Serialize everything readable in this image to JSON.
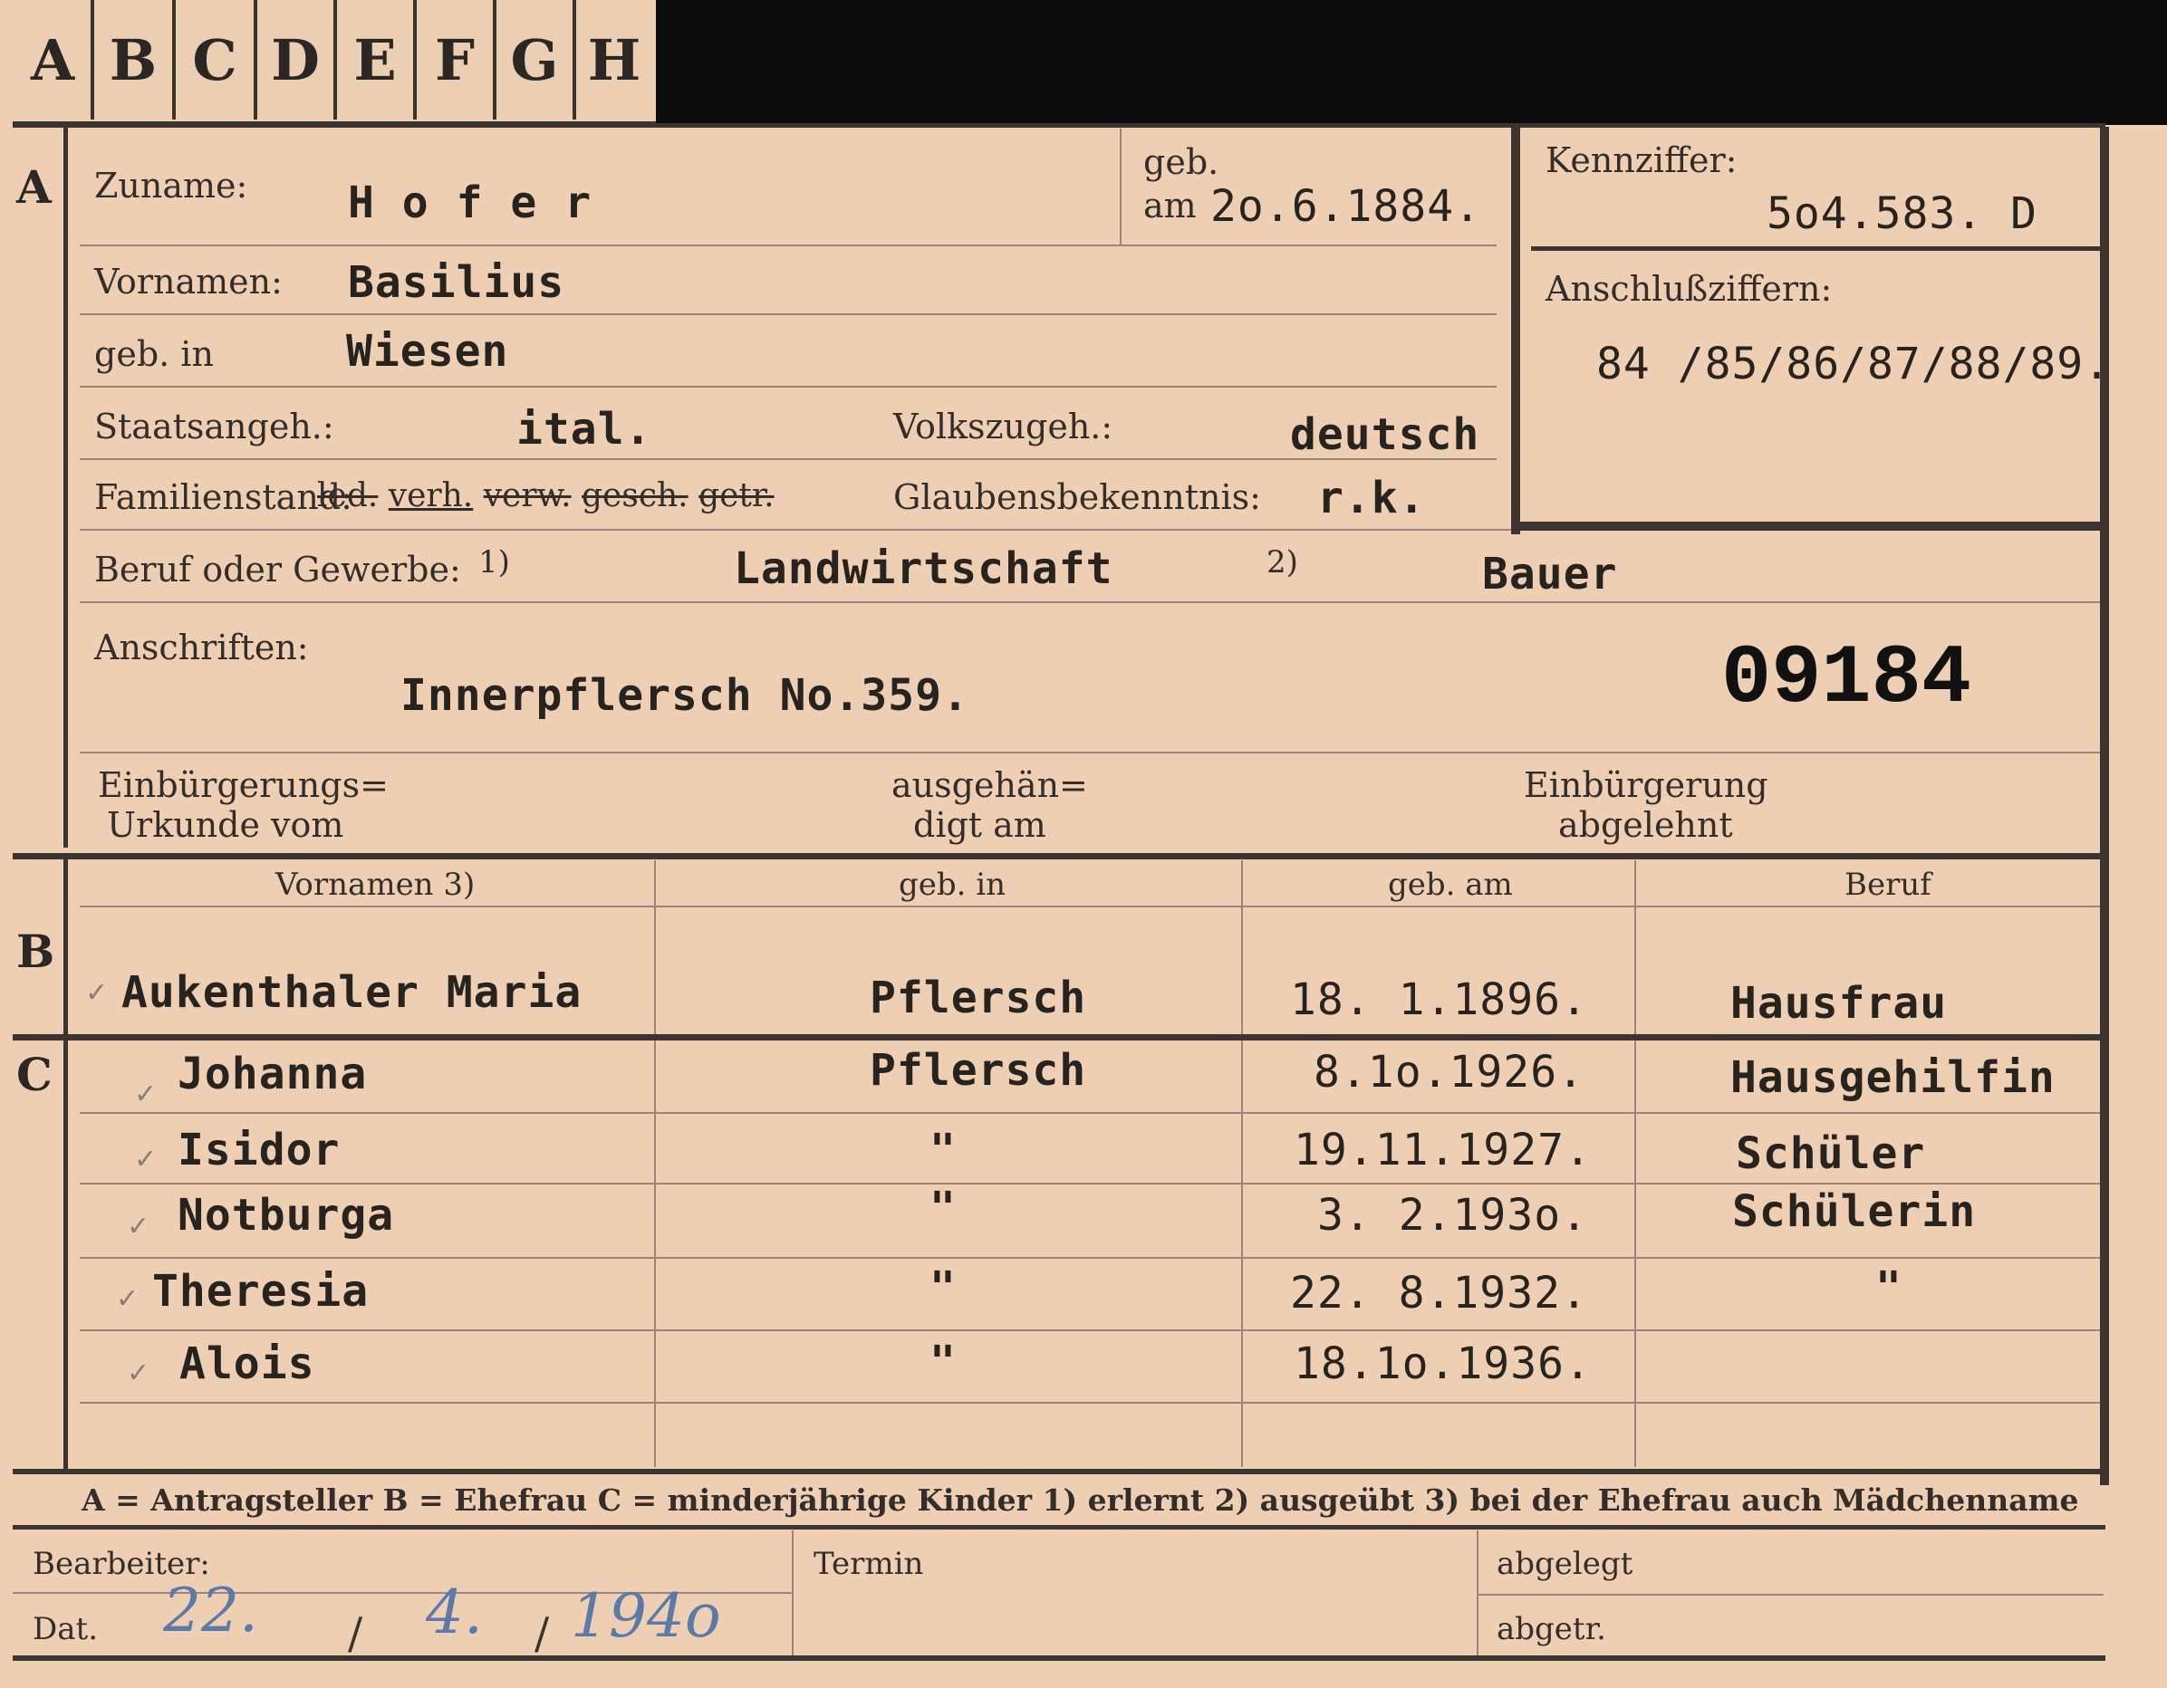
{
  "index_tabs": [
    "A",
    "B",
    "C",
    "D",
    "E",
    "F",
    "G",
    "H"
  ],
  "section_a": {
    "letter": "A",
    "surname_label": "Zuname:",
    "surname": "H o f e r",
    "birth_label_1": "geb.",
    "birth_label_2": "am",
    "birth_date": "2o.6.1884.",
    "given_names_label": "Vornamen:",
    "given_names": "Basilius",
    "birthplace_label": "geb. in",
    "birthplace": "Wiesen",
    "citizenship_label": "Staatsangeh.:",
    "citizenship": "ital.",
    "ethnicity_label": "Volkszugeh.:",
    "ethnicity": "deutsch",
    "marital_label": "Familienstand:",
    "marital_options": [
      "led.",
      "verh.",
      "verw.",
      "gesch.",
      "getr."
    ],
    "marital_selected": "verh.",
    "religion_label": "Glaubensbekenntnis:",
    "religion": "r.k.",
    "occupation_label": "Beruf oder Gewerbe:",
    "occupation_learned_mark": "1)",
    "occupation_learned": "Landwirtschaft",
    "occupation_practiced_mark": "2)",
    "occupation_practiced": "Bauer",
    "address_label": "Anschriften:",
    "address": "Innerpflersch  No.359.",
    "stamp_number": "09184",
    "naturalization_cert_label_1": "Einbürgerungs=",
    "naturalization_cert_label_2": "Urkunde vom",
    "handed_out_label_1": "ausgehän=",
    "handed_out_label_2": "digt am",
    "naturalization_refused_label_1": "Einbürgerung",
    "naturalization_refused_label_2": "abgelehnt"
  },
  "reference": {
    "id_label": "Kennziffer:",
    "id_value": "5o4.583.  D",
    "connected_label": "Anschlußziffern:",
    "connected_value": "84 /85/86/87/88/89."
  },
  "table_headers": {
    "given_names": "Vornamen 3)",
    "birthplace": "geb. in",
    "birth_date": "geb. am",
    "occupation": "Beruf"
  },
  "section_b": {
    "letter": "B",
    "rows": [
      {
        "name": "Aukenthaler Maria",
        "place": "Pflersch",
        "date": "18. 1.1896.",
        "occupation": "Hausfrau"
      }
    ]
  },
  "section_c": {
    "letter": "C",
    "rows": [
      {
        "name": "Johanna",
        "place": "Pflersch",
        "date": "8.1o.1926.",
        "occupation": "Hausgehilfin"
      },
      {
        "name": "Isidor",
        "place": "\"",
        "date": "19.11.1927.",
        "occupation": "Schüler"
      },
      {
        "name": "Notburga",
        "place": "\"",
        "date": "3. 2.193o.",
        "occupation": "Schülerin"
      },
      {
        "name": "Theresia",
        "place": "\"",
        "date": "22. 8.1932.",
        "occupation": "\""
      },
      {
        "name": "Alois",
        "place": "\"",
        "date": "18.1o.1936.",
        "occupation": ""
      },
      {
        "name": "",
        "place": "",
        "date": "",
        "occupation": ""
      }
    ]
  },
  "legend": "A = Antragsteller   B = Ehefrau   C = minderjährige Kinder   1) erlernt   2) ausgeübt   3) bei der Ehefrau auch Mädchenname",
  "footer": {
    "clerk_label": "Bearbeiter:",
    "date_label": "Dat.",
    "date_day": "22.",
    "date_month": "4.",
    "date_year": "194o",
    "appointment_label": "Termin",
    "filed_label": "abgelegt",
    "filed_by_label": "abgetr."
  },
  "colors": {
    "paper": "#efcfb4",
    "ink": "#2e2a26",
    "rule": "#3b3431",
    "handwriting": "#5b7aa8"
  }
}
